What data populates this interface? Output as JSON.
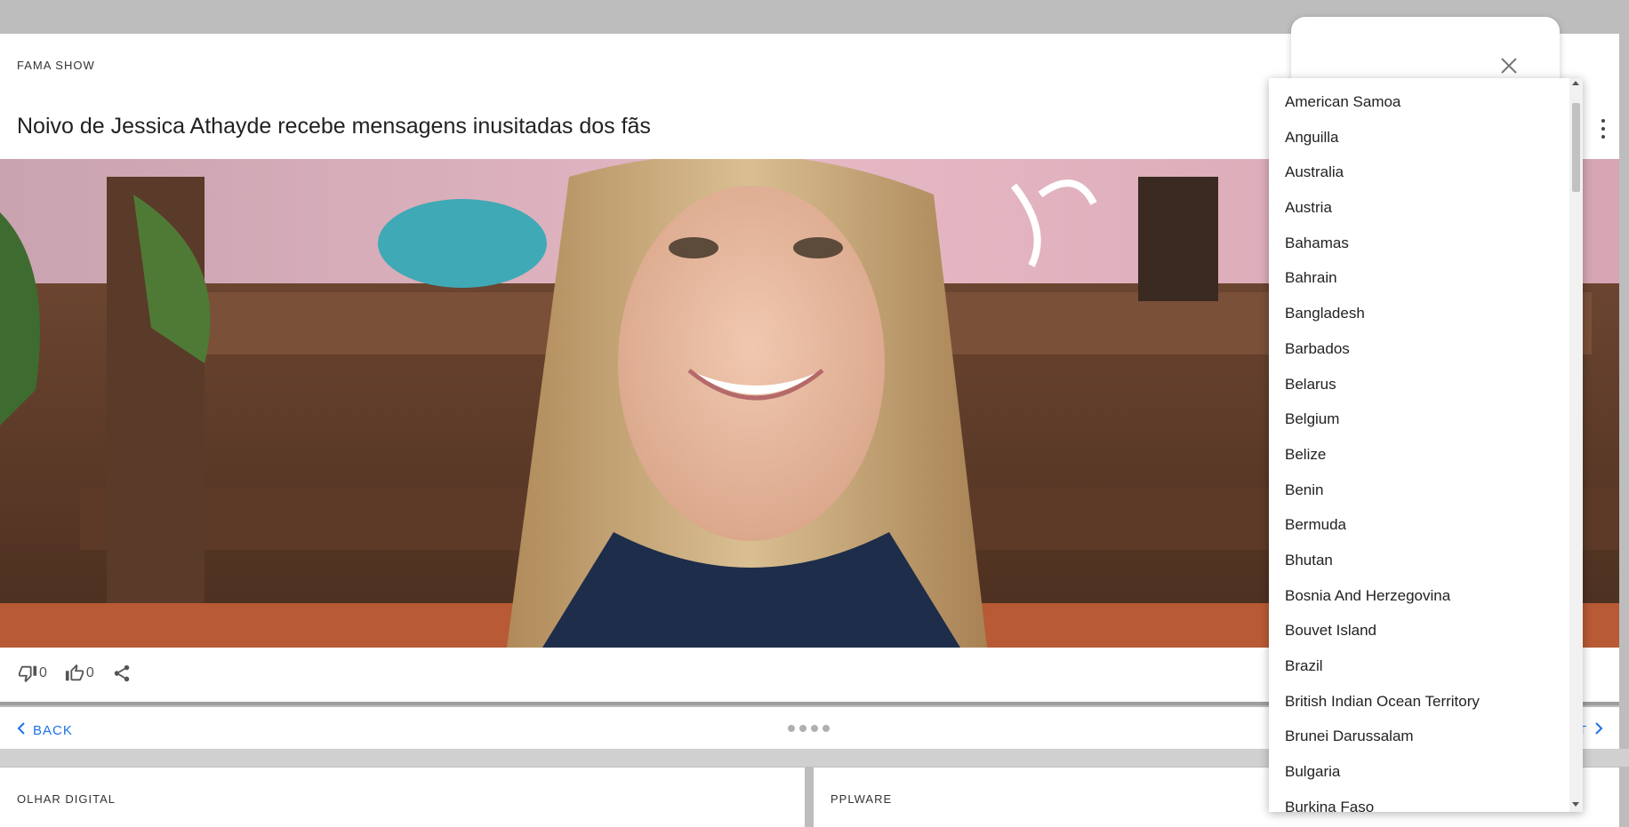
{
  "article": {
    "source": "FAMA SHOW",
    "title": "Noivo de Jessica Athayde recebe mensagens inusitadas dos fãs",
    "dislikes": "0",
    "likes": "0"
  },
  "nav": {
    "back_label": "BACK",
    "next_label": "T",
    "dot_count": 4
  },
  "cards": [
    {
      "source": "OLHAR DIGITAL"
    },
    {
      "source": "PPLWARE"
    }
  ],
  "dropdown": {
    "options": [
      "American Samoa",
      "Anguilla",
      "Australia",
      "Austria",
      "Bahamas",
      "Bahrain",
      "Bangladesh",
      "Barbados",
      "Belarus",
      "Belgium",
      "Belize",
      "Benin",
      "Bermuda",
      "Bhutan",
      "Bosnia And Herzegovina",
      "Bouvet Island",
      "Brazil",
      "British Indian Ocean Territory",
      "Brunei Darussalam",
      "Bulgaria",
      "Burkina Faso"
    ]
  },
  "colors": {
    "link": "#1a73e8",
    "background": "#bdbdbd"
  }
}
